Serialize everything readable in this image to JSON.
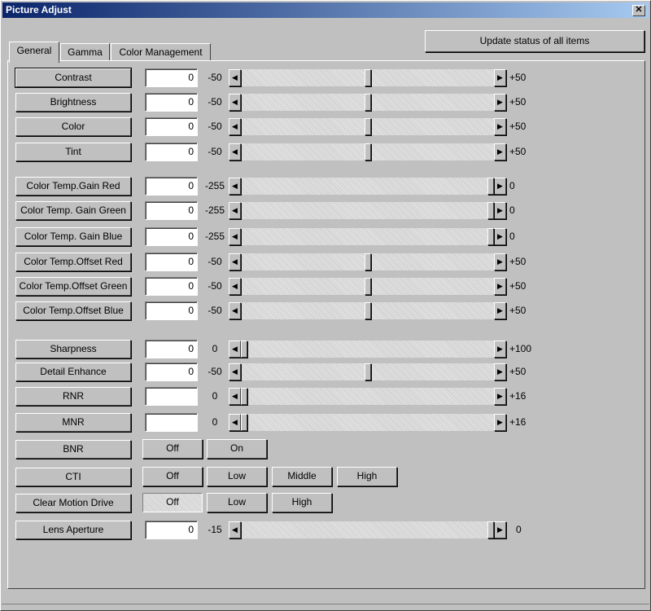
{
  "window": {
    "title": "Picture Adjust",
    "close_glyph": "✕"
  },
  "update_button": "Update status of all items",
  "tabs": [
    {
      "label": "General",
      "active": true
    },
    {
      "label": "Gamma",
      "active": false
    },
    {
      "label": "Color Management",
      "active": false
    }
  ],
  "arrows": {
    "left": "◀",
    "right": "▶"
  },
  "sliders": [
    {
      "key": "contrast",
      "label": "Contrast",
      "value": "0",
      "min": "-50",
      "max": "+50",
      "level": 0.5,
      "focused": true
    },
    {
      "key": "brightness",
      "label": "Brightness",
      "value": "0",
      "min": "-50",
      "max": "+50",
      "level": 0.5
    },
    {
      "key": "color",
      "label": "Color",
      "value": "0",
      "min": "-50",
      "max": "+50",
      "level": 0.5
    },
    {
      "key": "tint",
      "label": "Tint",
      "value": "0",
      "min": "-50",
      "max": "+50",
      "level": 0.5
    },
    {
      "key": "gain-red",
      "label": "Color Temp.Gain Red",
      "value": "0",
      "min": "-255",
      "max": "0",
      "level": 1.0
    },
    {
      "key": "gain-green",
      "label": "Color Temp. Gain Green",
      "value": "0",
      "min": "-255",
      "max": "0",
      "level": 1.0
    },
    {
      "key": "gain-blue",
      "label": "Color Temp. Gain Blue",
      "value": "0",
      "min": "-255",
      "max": "0",
      "level": 1.0
    },
    {
      "key": "offset-red",
      "label": "Color Temp.Offset Red",
      "value": "0",
      "min": "-50",
      "max": "+50",
      "level": 0.5
    },
    {
      "key": "offset-green",
      "label": "Color Temp.Offset Green",
      "value": "0",
      "min": "-50",
      "max": "+50",
      "level": 0.5
    },
    {
      "key": "offset-blue",
      "label": "Color Temp.Offset Blue",
      "value": "0",
      "min": "-50",
      "max": "+50",
      "level": 0.5
    },
    {
      "key": "sharpness",
      "label": "Sharpness",
      "value": "0",
      "min": "0",
      "max": "+100",
      "level": 0.0
    },
    {
      "key": "detail-enhance",
      "label": "Detail Enhance",
      "value": "0",
      "min": "-50",
      "max": "+50",
      "level": 0.5
    },
    {
      "key": "rnr",
      "label": "RNR",
      "value": "",
      "min": "0",
      "max": "+16",
      "level": 0.0
    },
    {
      "key": "mnr",
      "label": "MNR",
      "value": "",
      "min": "0",
      "max": "+16",
      "level": 0.0
    }
  ],
  "option_rows": [
    {
      "key": "bnr",
      "label": "BNR",
      "options": [
        {
          "label": "Off",
          "selected": false
        },
        {
          "label": "On",
          "selected": false
        }
      ]
    },
    {
      "key": "cti",
      "label": "CTI",
      "options": [
        {
          "label": "Off",
          "selected": false
        },
        {
          "label": "Low",
          "selected": false
        },
        {
          "label": "Middle",
          "selected": false
        },
        {
          "label": "High",
          "selected": false
        }
      ]
    },
    {
      "key": "clear-motion-drive",
      "label": "Clear Motion Drive",
      "options": [
        {
          "label": "Off",
          "selected": true
        },
        {
          "label": "Low",
          "selected": false
        },
        {
          "label": "High",
          "selected": false
        }
      ]
    }
  ],
  "lens_aperture": {
    "key": "lens-aperture",
    "label": "Lens Aperture",
    "value": "0",
    "min": "-15",
    "max": "0",
    "level": 1.0
  }
}
